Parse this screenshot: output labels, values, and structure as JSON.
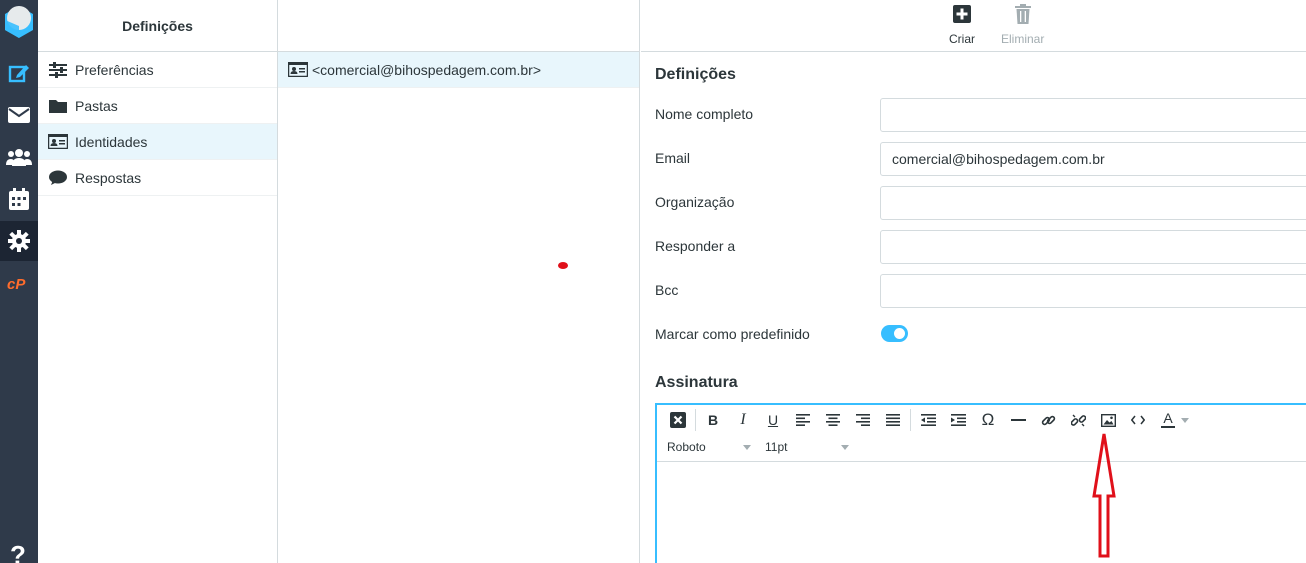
{
  "rail": {
    "icons": [
      "logo-icon",
      "compose-icon",
      "mail-icon",
      "contacts-icon",
      "calendar-icon",
      "settings-icon",
      "cpanel-icon",
      "help-icon"
    ],
    "help_label": "?",
    "colors": {
      "accent": "#37beff",
      "rail_bg": "#2f3a4a",
      "cpanel": "#ff6c2c"
    }
  },
  "settings_panel": {
    "title": "Definições",
    "items": [
      {
        "label": "Preferências",
        "icon": "sliders-icon"
      },
      {
        "label": "Pastas",
        "icon": "folder-icon"
      },
      {
        "label": "Identidades",
        "icon": "id-card-icon",
        "selected": true
      },
      {
        "label": "Respostas",
        "icon": "comment-icon"
      }
    ]
  },
  "identities": {
    "items": [
      {
        "label": "<comercial@bihospedagem.com.br>",
        "icon": "id-card-icon"
      }
    ]
  },
  "toolbar": {
    "create_label": "Criar",
    "delete_label": "Eliminar"
  },
  "form": {
    "section_title": "Definições",
    "fields": {
      "name": {
        "label": "Nome completo",
        "value": ""
      },
      "email": {
        "label": "Email",
        "value": "comercial@bihospedagem.com.br"
      },
      "organization": {
        "label": "Organização",
        "value": ""
      },
      "reply_to": {
        "label": "Responder a",
        "value": ""
      },
      "bcc": {
        "label": "Bcc",
        "value": ""
      }
    },
    "default_label": "Marcar como predefinido",
    "default_on": true
  },
  "signature": {
    "title": "Assinatura",
    "font": "Roboto",
    "size": "11pt",
    "tools": [
      "html-mode-icon",
      "bold-icon",
      "italic-icon",
      "underline-icon",
      "align-left-icon",
      "align-center-icon",
      "align-right-icon",
      "align-justify-icon",
      "outdent-icon",
      "indent-icon",
      "special-char-icon",
      "horizontal-rule-icon",
      "link-icon",
      "unlink-icon",
      "image-icon",
      "source-code-icon",
      "text-color-icon"
    ]
  }
}
